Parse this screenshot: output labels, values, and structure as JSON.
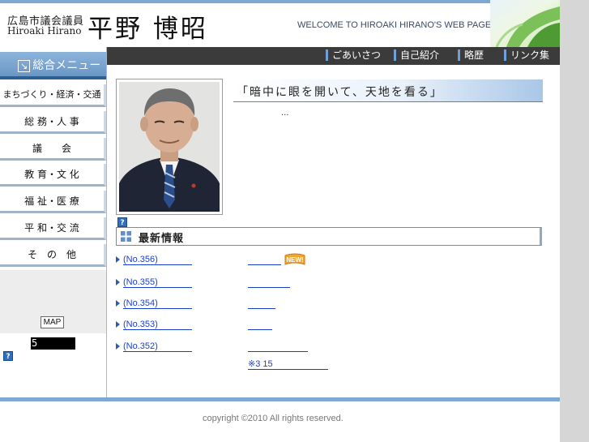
{
  "header": {
    "title_line1": "広島市議会議員",
    "title_line2": "Hiroaki Hirano",
    "name": "平野 博昭",
    "welcome": "WELCOME TO HIROAKI HIRANO'S  WEB PAGE"
  },
  "nav": {
    "items": [
      {
        "label": "ごあいさつ"
      },
      {
        "label": "自己紹介"
      },
      {
        "label": "略歴"
      },
      {
        "label": "リンク集"
      }
    ]
  },
  "sidebar": {
    "menu_title": "総合メニュー",
    "menu_title_icon": "arrow-down-right-icon",
    "items": [
      {
        "label": "まちづくり・経済・交通"
      },
      {
        "label": "総 務・人 事"
      },
      {
        "label": "議　　会"
      },
      {
        "label": "教 育・文 化"
      },
      {
        "label": "福 祉・医 療"
      },
      {
        "label": "平 和・交 流"
      },
      {
        "label": "そ　の　他"
      }
    ],
    "map_label": "MAP",
    "counter": "5",
    "help_glyph": "?"
  },
  "main": {
    "quote": "「暗中に眼を開いて、天地を看る」",
    "ellipsis": "...",
    "help_glyph": "?",
    "news_title": "最新情報",
    "news": [
      {
        "link": "(No.356)",
        "has_new": true
      },
      {
        "link": "(No.355)",
        "has_new": false
      },
      {
        "link": "(No.354)",
        "has_new": false
      },
      {
        "link": "(No.353)",
        "has_new": false
      },
      {
        "link": "(No.352)",
        "has_new": false
      }
    ],
    "new_badge": "NEW!",
    "footnote": "※3 15"
  },
  "footer": {
    "copyright": "copyright ©2010 All rights reserved."
  },
  "colors": {
    "accent_blue": "#7fa9d3",
    "nav_bg": "#3b3b3b",
    "link": "#1a3fd0",
    "menu_title_bg": "#6a97c6"
  }
}
